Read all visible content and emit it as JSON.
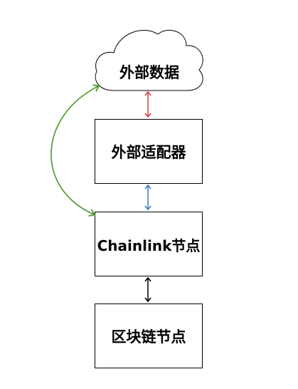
{
  "nodes": {
    "cloud": {
      "label": "外部数据"
    },
    "adapter": {
      "label": "外部适配器"
    },
    "chainlink": {
      "label": "Chainlink节点"
    },
    "blockchain": {
      "label": "区块链节点"
    }
  },
  "colors": {
    "background": "#ffffff",
    "node_border": "#000000",
    "text": "#000000",
    "arrow_cloud_adapter": "#d9413a",
    "arrow_adapter_chainlink": "#3a7ec3",
    "arrow_chainlink_blockchain": "#000000",
    "arrow_cloud_chainlink": "#4a9a2e"
  }
}
